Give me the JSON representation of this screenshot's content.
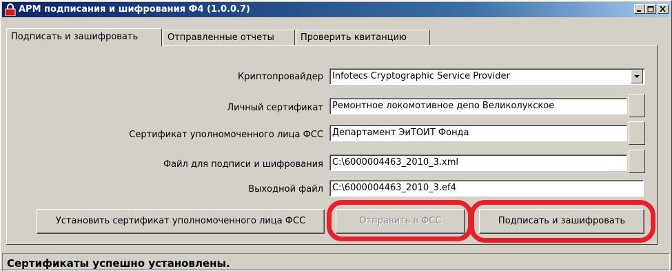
{
  "window": {
    "title": "АРМ  подписания и шифрования Ф4 (1.0.0.7)",
    "icon": "lock-icon",
    "title_color": "#0a246a"
  },
  "tabs": [
    {
      "label": "Подписать и зашифровать",
      "active": true
    },
    {
      "label": "Отправленные отчеты",
      "active": false
    },
    {
      "label": "Проверить квитанцию",
      "active": false
    }
  ],
  "form": {
    "crypto_provider": {
      "label": "Криптопровайдер",
      "value": "Infotecs Cryptographic Service Provider"
    },
    "personal_cert": {
      "label": "Личный сертификат",
      "value": "Ремонтное локомотивное депо Великолукское"
    },
    "fss_cert": {
      "label": "Сертификат уполномоченного лица ФСС",
      "value": "Департамент ЭиТОИТ Фонда"
    },
    "sign_file": {
      "label": "Файл для подписи и шифрования",
      "value": "C:\\6000004463_2010_3.xml"
    },
    "output_file": {
      "label": "Выходной файл",
      "value": "C:\\6000004463_2010_3.ef4"
    }
  },
  "buttons": {
    "install_cert": "Установить сертификат уполномоченного лица ФСС",
    "send_fss": "Отправить в ФСС",
    "sign_encrypt": "Подписать и зашифровать"
  },
  "status": "Сертификаты успешно установлены.",
  "colors": {
    "highlight": "#e8202a",
    "face": "#d4d0c8"
  }
}
